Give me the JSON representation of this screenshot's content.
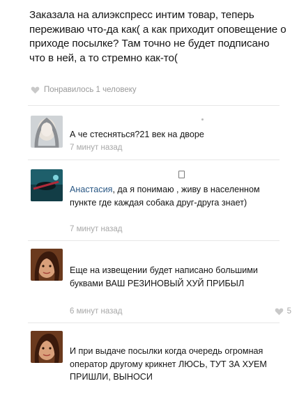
{
  "post": {
    "text": "Заказала на алиэкспресс интим товар, теперь переживаю что-да как( а как приходит оповещение о приходе посылке? Там точно не будет подписано что в ней, а то стремно как-то(",
    "likes_label": "Понравилось 1 человеку"
  },
  "comments": [
    {
      "text": "А че стесняться?21 век на дворе",
      "time": "7 минут назад"
    },
    {
      "name": "Анастасия",
      "text": ", да я понимаю , живу в населенном пункте где каждая собака друг-друга знает)",
      "time": "7 минут назад"
    },
    {
      "text": "Еще на извещении будет написано большими буквами ВАШ РЕЗИНОВЫЙ ХУЙ ПРИБЫЛ",
      "time": "6 минут назад",
      "likes": "5"
    },
    {
      "text": "И при выдаче посылки когда очередь огромная оператор другому крикнет ЛЮСЬ, ТУТ ЗА ХУЕМ ПРИШЛИ, ВЫНОСИ"
    }
  ],
  "colors": {
    "name_link": "#2a5885",
    "muted": "#a8a8a8",
    "divider": "#e6e6e6"
  }
}
